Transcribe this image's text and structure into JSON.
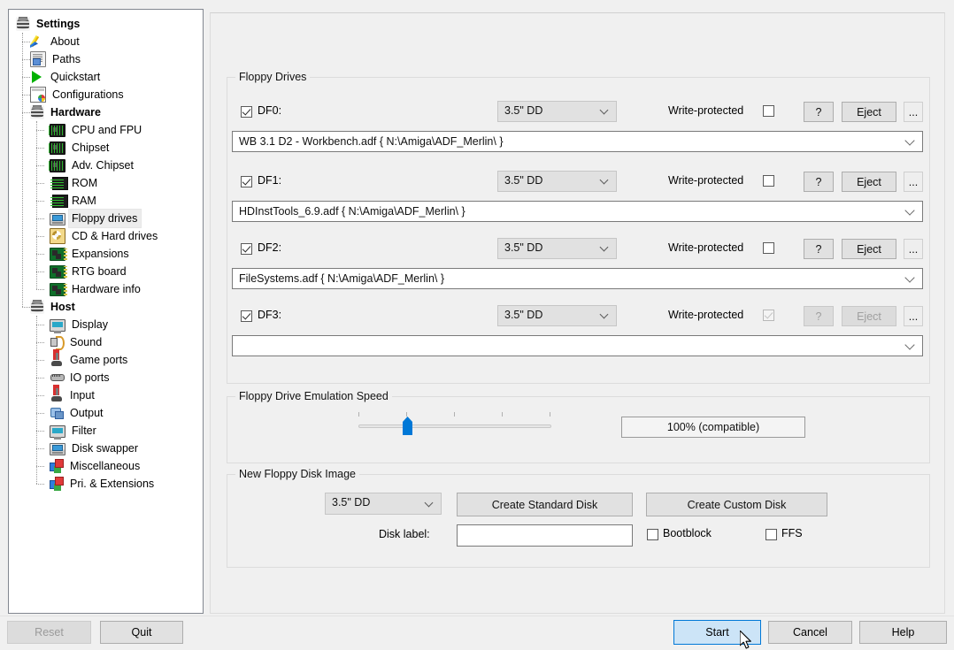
{
  "window": {
    "title": "Settings"
  },
  "sidebar": {
    "items": [
      {
        "label": "Settings",
        "icon": "disc-stack-icon",
        "level": 0,
        "bold": true,
        "selected": false
      },
      {
        "label": "About",
        "icon": "pencil-icon",
        "level": 1,
        "bold": false,
        "selected": false
      },
      {
        "label": "Paths",
        "icon": "document-icon",
        "level": 1,
        "bold": false,
        "selected": false
      },
      {
        "label": "Quickstart",
        "icon": "play-icon",
        "level": 1,
        "bold": false,
        "selected": false
      },
      {
        "label": "Configurations",
        "icon": "config-icon",
        "level": 1,
        "bold": false,
        "selected": false
      },
      {
        "label": "Hardware",
        "icon": "disc-stack-icon",
        "level": 1,
        "bold": true,
        "selected": false
      },
      {
        "label": "CPU and FPU",
        "icon": "chip-icon",
        "level": 2,
        "bold": false,
        "selected": false
      },
      {
        "label": "Chipset",
        "icon": "chip-icon",
        "level": 2,
        "bold": false,
        "selected": false
      },
      {
        "label": "Adv. Chipset",
        "icon": "chip-icon",
        "level": 2,
        "bold": false,
        "selected": false
      },
      {
        "label": "ROM",
        "icon": "rom-icon",
        "level": 2,
        "bold": false,
        "selected": false
      },
      {
        "label": "RAM",
        "icon": "rom-icon",
        "level": 2,
        "bold": false,
        "selected": false
      },
      {
        "label": "Floppy drives",
        "icon": "floppy-icon",
        "level": 2,
        "bold": false,
        "selected": true
      },
      {
        "label": "CD & Hard drives",
        "icon": "cd-icon",
        "level": 2,
        "bold": false,
        "selected": false
      },
      {
        "label": "Expansions",
        "icon": "board-icon",
        "level": 2,
        "bold": false,
        "selected": false
      },
      {
        "label": "RTG board",
        "icon": "board-icon",
        "level": 2,
        "bold": false,
        "selected": false
      },
      {
        "label": "Hardware info",
        "icon": "board-icon",
        "level": 2,
        "bold": false,
        "selected": false
      },
      {
        "label": "Host",
        "icon": "disc-stack-icon",
        "level": 1,
        "bold": true,
        "selected": false
      },
      {
        "label": "Display",
        "icon": "monitor-icon",
        "level": 2,
        "bold": false,
        "selected": false
      },
      {
        "label": "Sound",
        "icon": "sound-icon",
        "level": 2,
        "bold": false,
        "selected": false
      },
      {
        "label": "Game ports",
        "icon": "joystick-icon",
        "level": 2,
        "bold": false,
        "selected": false
      },
      {
        "label": "IO ports",
        "icon": "io-ports-icon",
        "level": 2,
        "bold": false,
        "selected": false
      },
      {
        "label": "Input",
        "icon": "joystick-icon",
        "level": 2,
        "bold": false,
        "selected": false
      },
      {
        "label": "Output",
        "icon": "output-icon",
        "level": 2,
        "bold": false,
        "selected": false
      },
      {
        "label": "Filter",
        "icon": "monitor-icon",
        "level": 2,
        "bold": false,
        "selected": false
      },
      {
        "label": "Disk swapper",
        "icon": "floppy-icon",
        "level": 2,
        "bold": false,
        "selected": false
      },
      {
        "label": "Miscellaneous",
        "icon": "blocks-icon",
        "level": 2,
        "bold": false,
        "selected": false
      },
      {
        "label": "Pri. & Extensions",
        "icon": "blocks-icon",
        "level": 2,
        "bold": false,
        "selected": false
      }
    ]
  },
  "floppy_drives": {
    "group_title": "Floppy Drives",
    "write_protected_label": "Write-protected",
    "help_button_label": "?",
    "eject_button_label": "Eject",
    "browse_button_label": "...",
    "drives": [
      {
        "name": "DF0:",
        "enabled": true,
        "type": "3.5\" DD",
        "write_protected": false,
        "write_protected_disabled": false,
        "path": "WB 3.1 D2 - Workbench.adf { N:\\Amiga\\ADF_Merlin\\ }",
        "controls_disabled": false
      },
      {
        "name": "DF1:",
        "enabled": true,
        "type": "3.5\" DD",
        "write_protected": false,
        "write_protected_disabled": false,
        "path": "HDInstTools_6.9.adf { N:\\Amiga\\ADF_Merlin\\ }",
        "controls_disabled": false
      },
      {
        "name": "DF2:",
        "enabled": true,
        "type": "3.5\" DD",
        "write_protected": false,
        "write_protected_disabled": false,
        "path": "FileSystems.adf { N:\\Amiga\\ADF_Merlin\\ }",
        "controls_disabled": false
      },
      {
        "name": "DF3:",
        "enabled": true,
        "type": "3.5\" DD",
        "write_protected": true,
        "write_protected_disabled": true,
        "path": "",
        "controls_disabled": true
      }
    ]
  },
  "emulation_speed": {
    "group_title": "Floppy Drive Emulation Speed",
    "value_label": "100% (compatible)",
    "slider": {
      "min": 0,
      "max": 4,
      "value": 1,
      "ticks": 5
    }
  },
  "new_disk_image": {
    "group_title": "New Floppy Disk Image",
    "type": "3.5\" DD",
    "create_standard_label": "Create Standard Disk",
    "create_custom_label": "Create Custom Disk",
    "disk_label_caption": "Disk label:",
    "disk_label_value": "",
    "disk_label_placeholder": "",
    "bootblock_label": "Bootblock",
    "bootblock_checked": false,
    "ffs_label": "FFS",
    "ffs_checked": false
  },
  "bottom_bar": {
    "reset_label": "Reset",
    "reset_disabled": true,
    "quit_label": "Quit",
    "start_label": "Start",
    "start_focused": true,
    "cancel_label": "Cancel",
    "help_label": "Help"
  },
  "colors": {
    "accent": "#0078d7",
    "focus_fill": "#cce4f7",
    "window_bg": "#f0f0f0",
    "field_bg": "#ffffff",
    "combo_bg": "#e1e1e1"
  }
}
